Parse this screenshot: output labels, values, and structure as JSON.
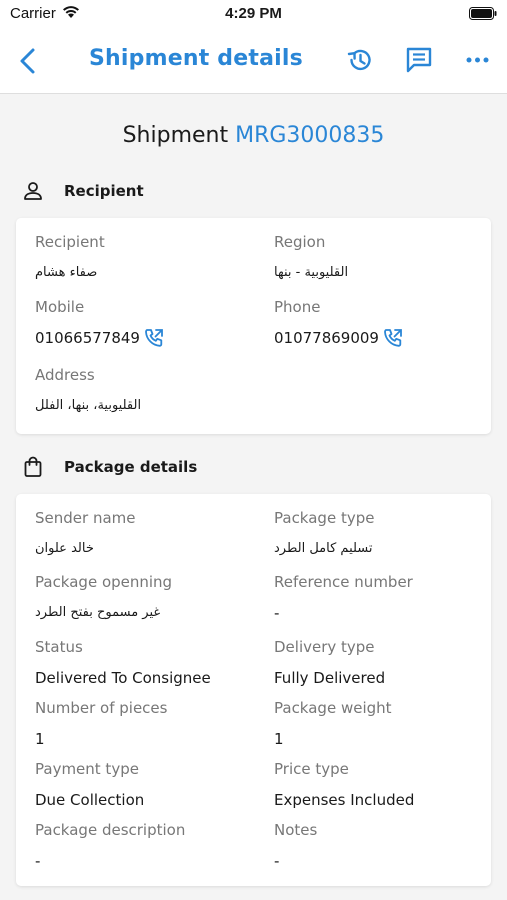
{
  "status_bar": {
    "carrier": "Carrier",
    "time": "4:29 PM"
  },
  "nav": {
    "title": "Shipment details",
    "icons": [
      "back-chevron-icon",
      "history-icon",
      "chat-icon",
      "more-icon"
    ],
    "accent_color": "#2a86d6"
  },
  "shipment": {
    "label": "Shipment",
    "code": "MRG3000835"
  },
  "recipient_section": {
    "title": "Recipient",
    "icon": "person-icon",
    "fields": {
      "recipient_label": "Recipient",
      "recipient_value": "صفاء هشام",
      "region_label": "Region",
      "region_value": "القليوبية - بنها",
      "mobile_label": "Mobile",
      "mobile_value": "01066577849",
      "phone_label": "Phone",
      "phone_value": "01077869009",
      "address_label": "Address",
      "address_value": "القليوبية، بنها، الفلل"
    }
  },
  "package_section": {
    "title": "Package details",
    "icon": "shopping-bag-icon",
    "fields": {
      "sender_name_label": "Sender name",
      "sender_name_value": "خالد علوان",
      "package_type_label": "Package type",
      "package_type_value": "تسليم كامل الطرد",
      "package_opening_label": "Package openning",
      "package_opening_value": "غير مسموح بفتح الطرد",
      "reference_number_label": "Reference number",
      "reference_number_value": "-",
      "status_label": "Status",
      "status_value": "Delivered To Consignee",
      "delivery_type_label": "Delivery type",
      "delivery_type_value": "Fully Delivered",
      "pieces_label": "Number of pieces",
      "pieces_value": "1",
      "weight_label": "Package weight",
      "weight_value": "1",
      "payment_type_label": "Payment type",
      "payment_type_value": "Due Collection",
      "price_type_label": "Price type",
      "price_type_value": "Expenses Included",
      "description_label": "Package description",
      "description_value": "-",
      "notes_label": "Notes",
      "notes_value": "-"
    }
  }
}
